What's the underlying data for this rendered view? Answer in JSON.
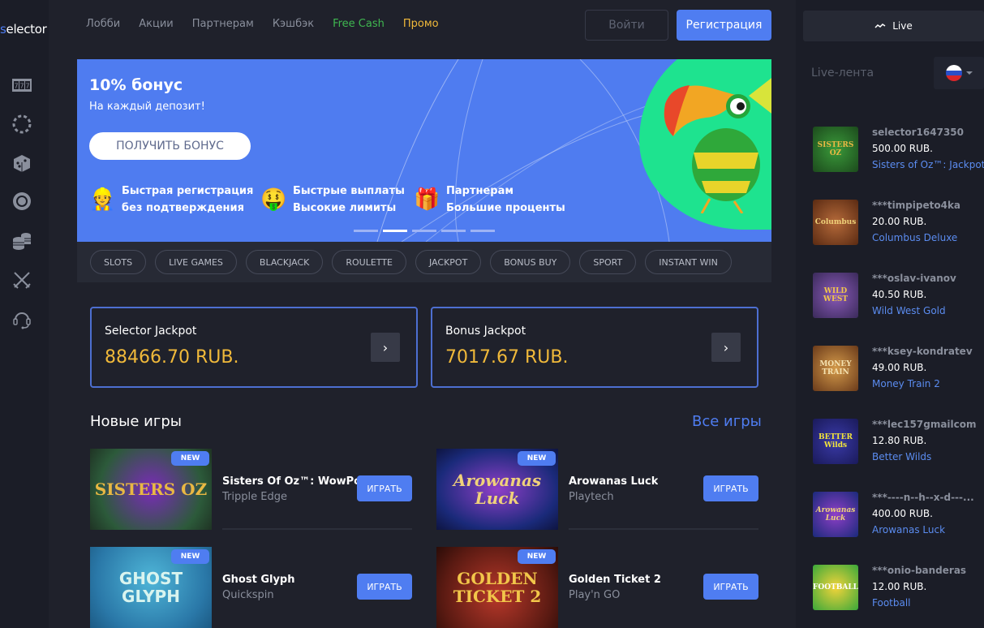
{
  "brand": {
    "logo_prefix": "s",
    "logo_rest": "elector"
  },
  "sidebar": {
    "icons": [
      "slots-777-icon",
      "roulette-ring-icon",
      "dice-icon",
      "target-chip-icon",
      "coins-stack-icon",
      "crossed-swords-icon",
      "headset-support-icon"
    ]
  },
  "nav": {
    "items": [
      "Лобби",
      "Акции",
      "Партнерам",
      "Кэшбэк",
      "Free Cash",
      "Промо"
    ],
    "login": "Войти",
    "register": "Регистрация"
  },
  "banner": {
    "title": "10% бонус",
    "subtitle": "На каждый депозит!",
    "cta": "ПОЛУЧИТЬ БОНУС",
    "features": [
      {
        "icon": "user-laptop-icon",
        "emoji": "👷",
        "line1": "Быстрая регистрация",
        "line2": "без подтверждения"
      },
      {
        "icon": "money-face-icon",
        "emoji": "🤑",
        "line1": "Быстрые выплаты",
        "line2": "Высокие лимиты"
      },
      {
        "icon": "gift-icon",
        "emoji": "🎁",
        "line1": "Партнерам",
        "line2": "Большие проценты"
      }
    ],
    "slides_total": 5,
    "active_slide": 2,
    "colors": {
      "background": "#4f7cf0",
      "blob": "#1ee38f"
    }
  },
  "categories": [
    "SLOTS",
    "LIVE GAMES",
    "BLACKJACK",
    "ROULETTE",
    "JACKPOT",
    "BONUS BUY",
    "SPORT",
    "INSTANT WIN"
  ],
  "jackpots": [
    {
      "name": "Selector Jackpot",
      "value": "88466.70 RUB."
    },
    {
      "name": "Bonus Jackpot",
      "value": "7017.67 RUB."
    }
  ],
  "new_games": {
    "title": "Новые игры",
    "all_link": "Все игры",
    "play_label": "ИГРАТЬ",
    "badge": "NEW",
    "items": [
      {
        "title": "Sisters Of Oz™: WowPot!™",
        "provider": "Tripple Edge",
        "art": "SISTERS OZ"
      },
      {
        "title": "Arowanas Luck",
        "provider": "Playtech",
        "art": "Arowanas Luck"
      },
      {
        "title": "Ghost Glyph",
        "provider": "Quickspin",
        "art": "GHOST GLYPH"
      },
      {
        "title": "Golden Ticket 2",
        "provider": "Play'n GO",
        "art": "GOLDEN TICKET 2"
      }
    ]
  },
  "live": {
    "tab_label": "Live",
    "feed_title": "Live-лента",
    "language": "ru",
    "feed": [
      {
        "user": "selector1647350",
        "amount": "500.00 RUB.",
        "game": "Sisters of Oz™: Jackpots",
        "art": "SISTERS OZ"
      },
      {
        "user": "***timpipeto4ka",
        "amount": "20.00 RUB.",
        "game": "Columbus Deluxe",
        "art": "Columbus"
      },
      {
        "user": "***oslav-ivanov",
        "amount": "40.50 RUB.",
        "game": "Wild West Gold",
        "art": "WILD WEST"
      },
      {
        "user": "***ksey-kondratev",
        "amount": "49.00 RUB.",
        "game": "Money Train 2",
        "art": "MONEY TRAIN"
      },
      {
        "user": "***lec157gmailcom",
        "amount": "12.80 RUB.",
        "game": "Better Wilds",
        "art": "BETTER Wilds"
      },
      {
        "user": "***----n--h--x-d---...",
        "amount": "400.00 RUB.",
        "game": "Arowanas Luck",
        "art": "Arowanas Luck"
      },
      {
        "user": "***onio-banderas",
        "amount": "12.00 RUB.",
        "game": "Football",
        "art": "FOOTBALL"
      }
    ]
  }
}
